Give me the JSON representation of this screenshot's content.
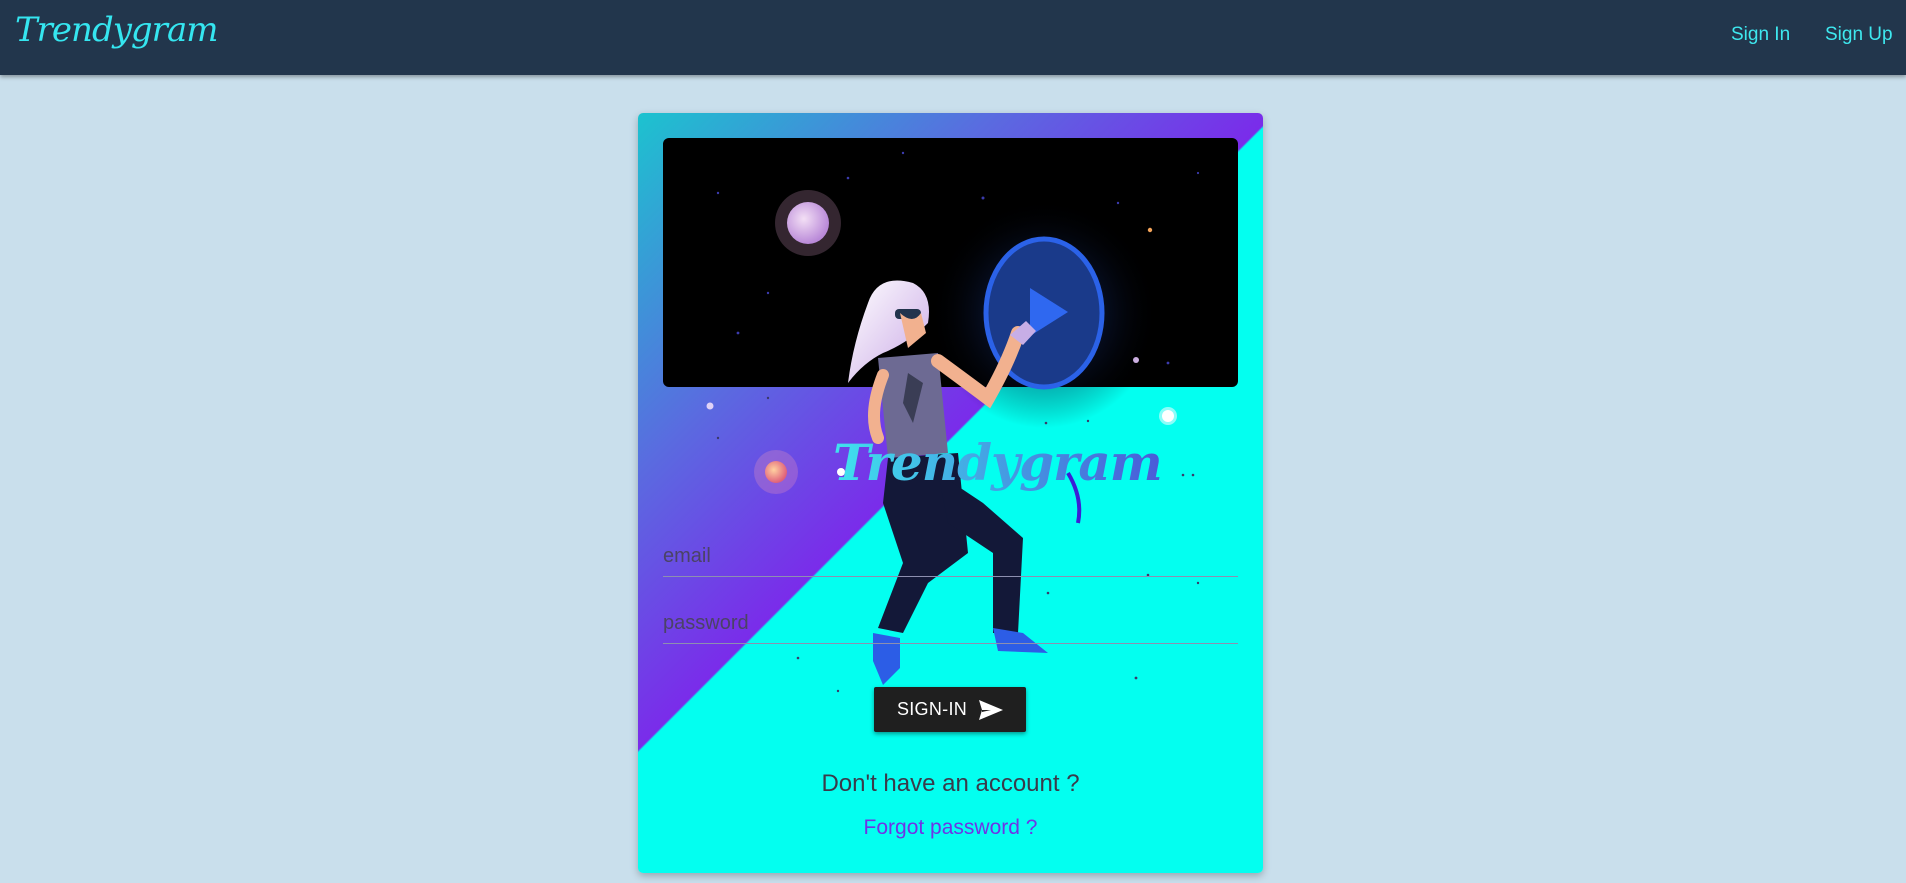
{
  "header": {
    "brand": "Trendygram",
    "nav": [
      {
        "label": "Sign In"
      },
      {
        "label": "Sign Up"
      }
    ]
  },
  "card": {
    "brand": "Trendygram",
    "email_placeholder": "email",
    "password_placeholder": "password",
    "signin_label": "SIGN-IN",
    "no_account_text": "Don't have an account ?",
    "forgot_text": "Forgot password ?"
  },
  "icons": {
    "play": "play-icon",
    "send": "send-icon"
  },
  "colors": {
    "header_bg": "#22364c",
    "page_bg": "#c9dfec",
    "accent_cyan": "#3ee8ef",
    "accent_purple": "#7a2cea",
    "card_cyan": "#03fff0"
  }
}
